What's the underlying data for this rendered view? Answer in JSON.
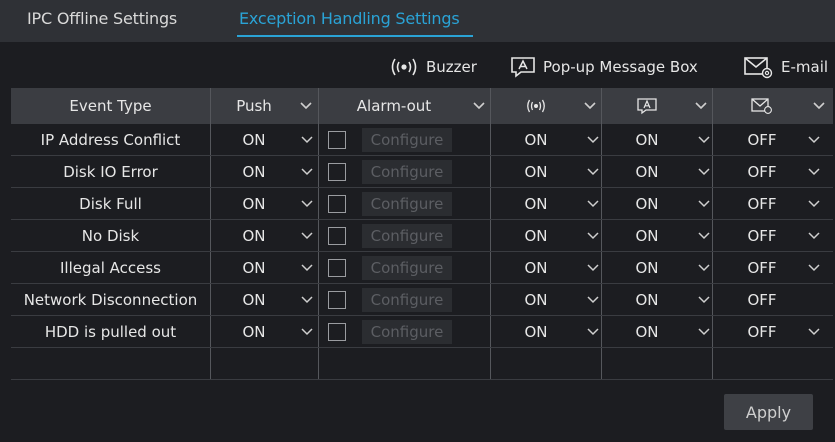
{
  "tabs": {
    "offline": "IPC Offline Settings",
    "exception": "Exception Handling Settings"
  },
  "legend": {
    "buzzer": "Buzzer",
    "popup": "Pop-up Message Box",
    "email": "E-mail"
  },
  "table": {
    "headers": {
      "event_type": "Event Type",
      "push": "Push",
      "alarm_out": "Alarm-out"
    },
    "rows": [
      {
        "event": "IP Address Conflict",
        "push": "ON",
        "configure": "Configure",
        "buzzer": "ON",
        "popup": "ON",
        "email": "OFF",
        "email_dropdown": true
      },
      {
        "event": "Disk IO Error",
        "push": "ON",
        "configure": "Configure",
        "buzzer": "ON",
        "popup": "ON",
        "email": "OFF",
        "email_dropdown": true
      },
      {
        "event": "Disk Full",
        "push": "ON",
        "configure": "Configure",
        "buzzer": "ON",
        "popup": "ON",
        "email": "OFF",
        "email_dropdown": true
      },
      {
        "event": "No Disk",
        "push": "ON",
        "configure": "Configure",
        "buzzer": "ON",
        "popup": "ON",
        "email": "OFF",
        "email_dropdown": true
      },
      {
        "event": "Illegal Access",
        "push": "ON",
        "configure": "Configure",
        "buzzer": "ON",
        "popup": "ON",
        "email": "OFF",
        "email_dropdown": true
      },
      {
        "event": "Network Disconnection",
        "push": "ON",
        "configure": "Configure",
        "buzzer": "ON",
        "popup": "ON",
        "email": "OFF",
        "email_dropdown": false
      },
      {
        "event": "HDD is pulled out",
        "push": "ON",
        "configure": "Configure",
        "buzzer": "ON",
        "popup": "ON",
        "email": "OFF",
        "email_dropdown": true
      }
    ]
  },
  "apply_label": "Apply",
  "colors": {
    "accent": "#2aa3d6",
    "background": "#1c1d21",
    "header": "#3b3d42"
  }
}
